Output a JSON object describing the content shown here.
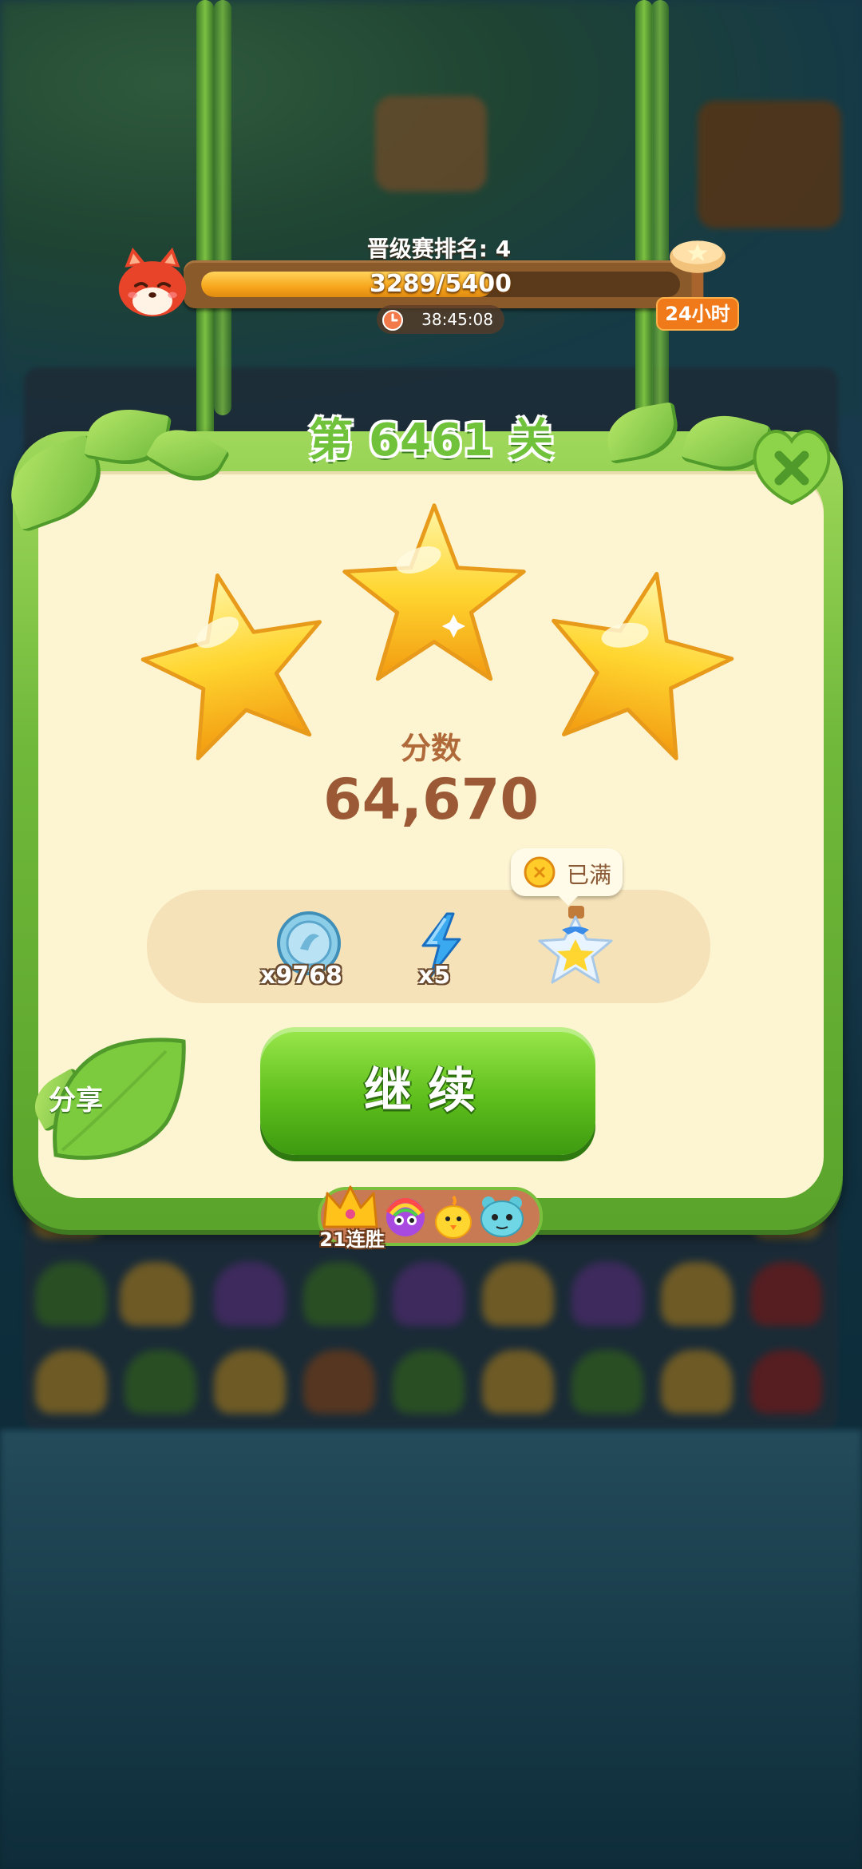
{
  "ranking": {
    "title": "晋级赛排名: 4",
    "progress_current": 3289,
    "progress_total": 5400,
    "progress_text": "3289/5400",
    "progress_fraction": 0.609,
    "timer": "38:45:08",
    "duration_badge": "24小时"
  },
  "panel": {
    "level_title": "第 6461 关",
    "stars_earned": 3,
    "stars_total": 3,
    "score_label": "分数",
    "score_value": "64,670"
  },
  "rewards": {
    "coins_count": "x9768",
    "energy_count": "x5",
    "full_badge": "已满",
    "items": [
      {
        "icon": "silver-coin-icon",
        "count": "x9768"
      },
      {
        "icon": "lightning-bolt-icon",
        "count": "x5"
      },
      {
        "icon": "star-jar-icon",
        "count": ""
      }
    ]
  },
  "buttons": {
    "continue": "继续",
    "share": "分享",
    "close": "close-icon"
  },
  "streak": {
    "label": "21连胜",
    "icons": [
      "crown-icon",
      "rainbow-owl-icon",
      "chick-icon",
      "blue-monster-icon"
    ]
  },
  "colors": {
    "panel_green": "#6fb83a",
    "panel_cream": "#fdf4d2",
    "progress_orange": "#f7a61c",
    "button_green": "#5fbf1c",
    "score_brown": "#9b5a35"
  }
}
